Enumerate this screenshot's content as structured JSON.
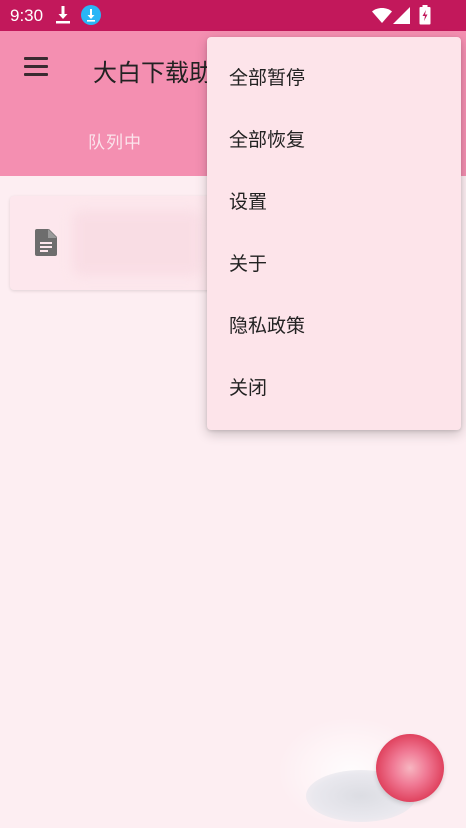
{
  "status_bar": {
    "time": "9:30",
    "icons": [
      "download-icon",
      "app-notification-icon",
      "wifi-icon",
      "signal-icon",
      "battery-charging-icon"
    ],
    "color": "#c2185b"
  },
  "app_bar": {
    "title": "大白下载助手",
    "color": "#f48fb1",
    "tabs": [
      {
        "label": "队列中"
      }
    ]
  },
  "task_list": {
    "items": [
      {
        "icon": "document-icon"
      }
    ]
  },
  "overflow_menu": {
    "items": [
      {
        "label": "全部暂停"
      },
      {
        "label": "全部恢复"
      },
      {
        "label": "设置"
      },
      {
        "label": "关于"
      },
      {
        "label": "隐私政策"
      },
      {
        "label": "关闭"
      }
    ]
  },
  "colors": {
    "background": "#fdeef2",
    "menu_background": "#fde4ea"
  }
}
